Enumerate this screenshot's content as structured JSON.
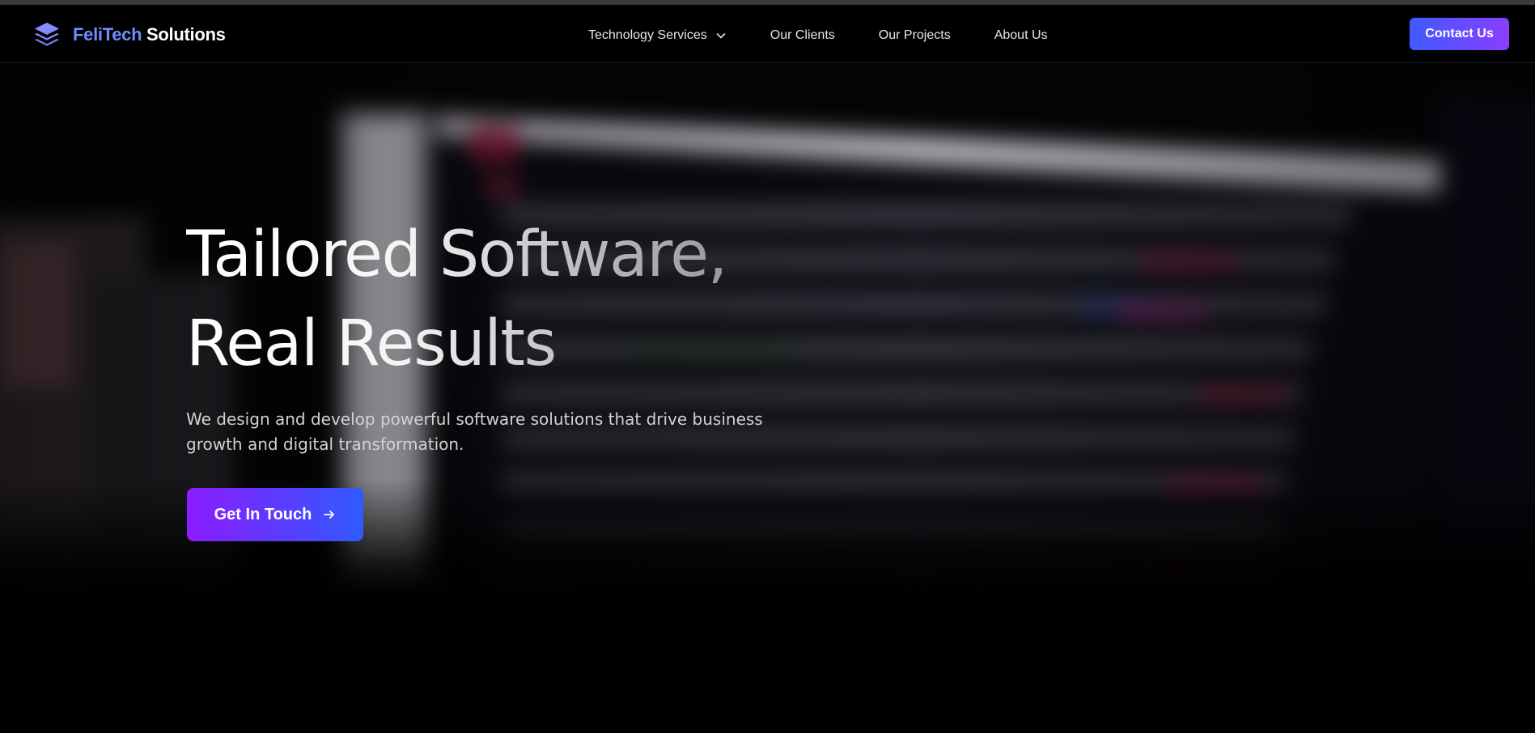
{
  "brand": {
    "name_part1": "FeliTech",
    "name_part2": "Solutions",
    "accent_color": "#6f8dff",
    "icon": "stacked-layers-icon"
  },
  "nav": {
    "items": [
      {
        "label": "Technology Services",
        "has_dropdown": true,
        "icon": "chevron-down-icon"
      },
      {
        "label": "Our Clients"
      },
      {
        "label": "Our Projects"
      },
      {
        "label": "About Us"
      }
    ],
    "contact_label": "Contact Us",
    "contact_gradient": [
      "#3f5bff",
      "#8a3dff"
    ]
  },
  "hero": {
    "title_line1": "Tailored Software,",
    "title_line2": "Real Results",
    "subtitle": "We design and develop powerful software solutions that drive business growth and digital transformation.",
    "cta_label": "Get In Touch",
    "cta_icon": "arrow-right-icon",
    "cta_gradient": [
      "#8b1cff",
      "#2f5bff"
    ],
    "background": "blurred-code-screen-photo"
  }
}
